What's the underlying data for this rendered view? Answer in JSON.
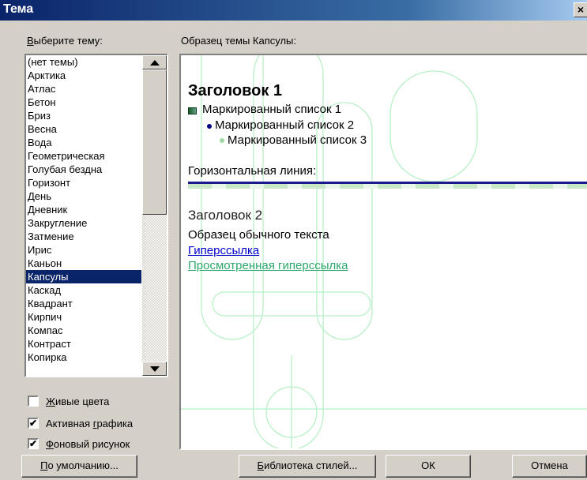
{
  "window": {
    "title": "Тема",
    "close_glyph": "×"
  },
  "theme_list": {
    "label_accel": "В",
    "label_rest": "ыберите тему:",
    "items": [
      "(нет темы)",
      "Арктика",
      "Атлас",
      "Бетон",
      "Бриз",
      "Весна",
      "Вода",
      "Геометрическая",
      "Голубая бездна",
      "Горизонт",
      "День",
      "Дневник",
      "Закругление",
      "Затмение",
      "Ирис",
      "Каньон",
      "Капсулы",
      "Каскад",
      "Квадрант",
      "Кирпич",
      "Компас",
      "Контраст",
      "Копирка"
    ],
    "selected": "Капсулы"
  },
  "preview": {
    "label": "Образец темы Капсулы:",
    "heading1": "Заголовок 1",
    "bullet1": "Маркированный список 1",
    "bullet2": "Маркированный список 2",
    "bullet3": "Маркированный список 3",
    "hr_label": "Горизонтальная линия:",
    "heading2": "Заголовок 2",
    "body_text": "Образец обычного текста",
    "link": "Гиперссылка",
    "visited_link": "Просмотренная гиперссылка"
  },
  "options": {
    "vivid_colors": {
      "accel": "Ж",
      "rest": "ивые цвета",
      "checked": false
    },
    "active_graphics": {
      "pre": "Активная ",
      "accel": "г",
      "rest": "рафика",
      "checked": true
    },
    "background_image": {
      "accel": "Ф",
      "rest": "оновый рисунок",
      "checked": true
    },
    "check_glyph": "✔"
  },
  "buttons": {
    "default": {
      "accel": "П",
      "rest": "о умолчанию..."
    },
    "style_gallery": {
      "accel": "Б",
      "rest": "иблиотека стилей..."
    },
    "ok": "ОК",
    "cancel": "Отмена"
  },
  "colors": {
    "titlebar": "#0a246a",
    "selection": "#0a246a",
    "link": "#0000cc",
    "visited_link": "#2ea86a",
    "theme_decor": "#b8f0c8"
  }
}
